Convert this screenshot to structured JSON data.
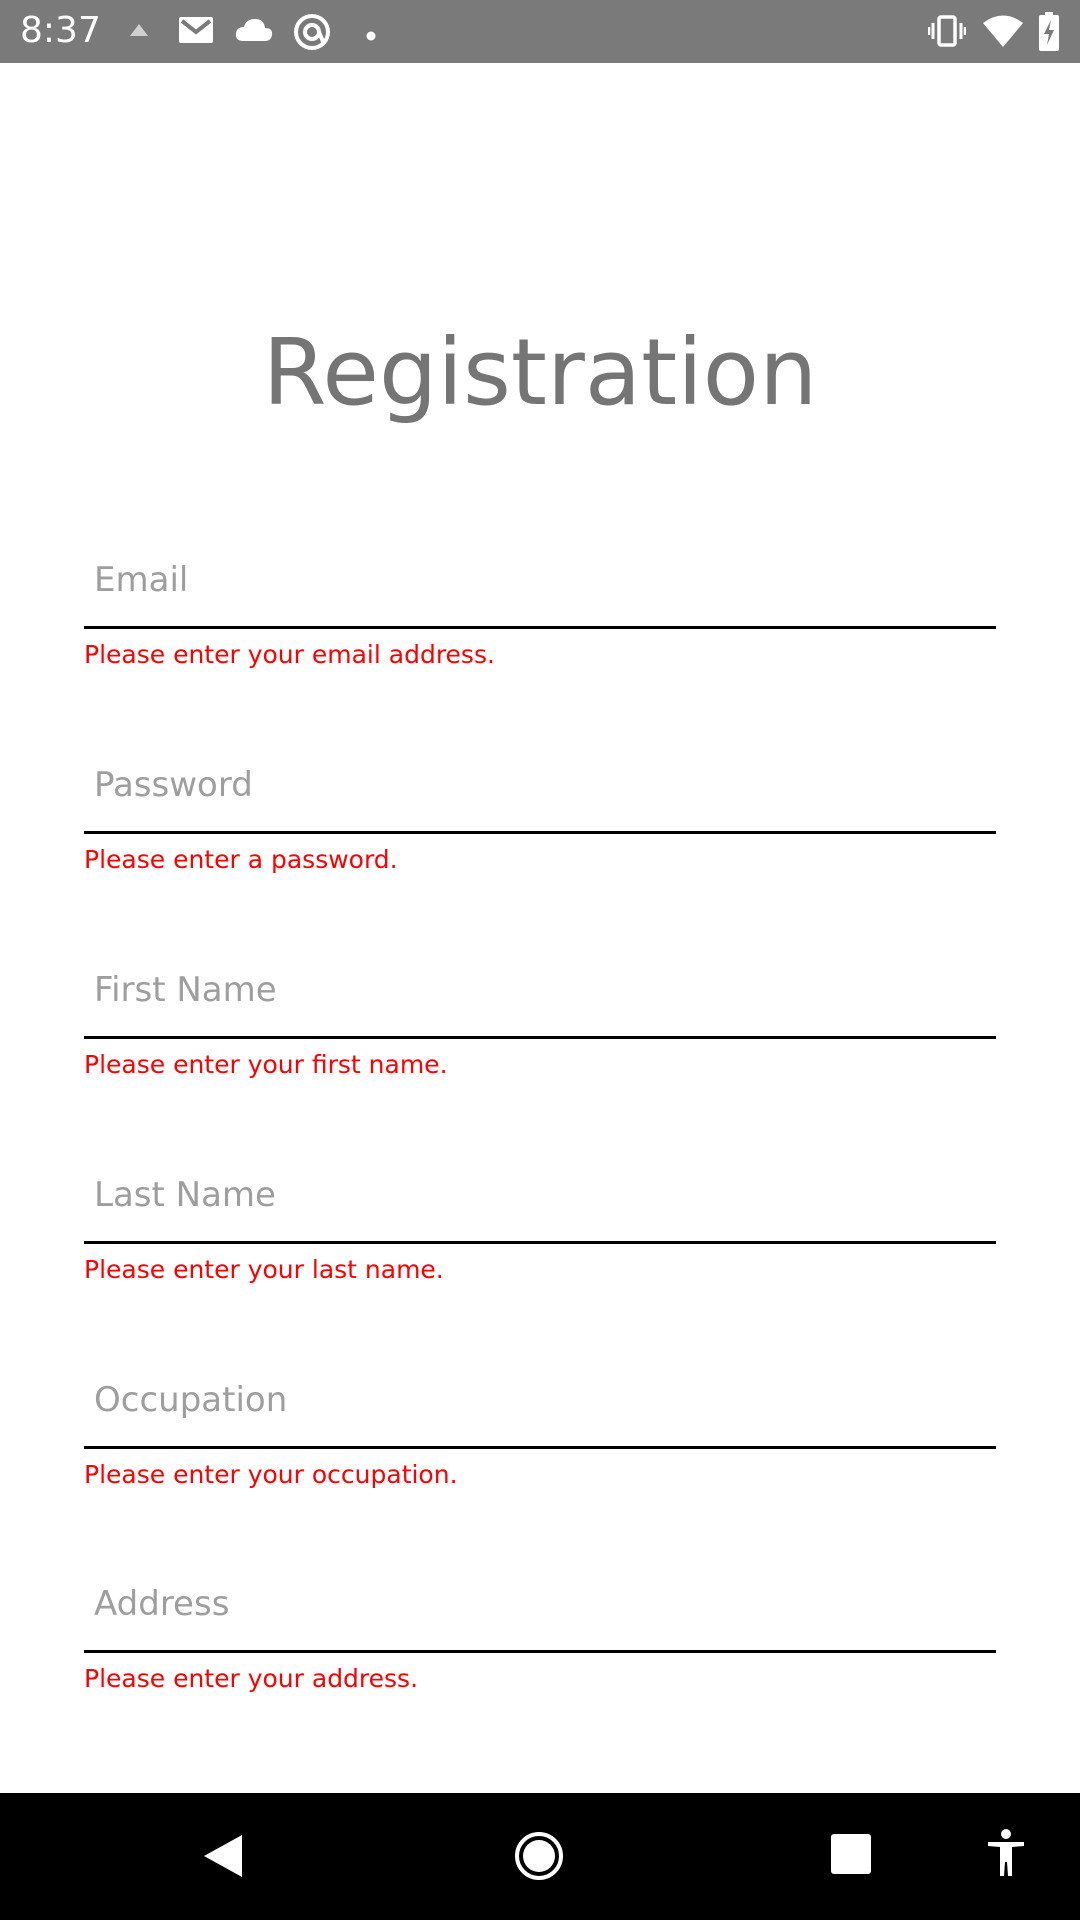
{
  "status_bar": {
    "time": "8:37",
    "left_icons": [
      "drive-sync-icon",
      "gmail-icon",
      "cloud-icon",
      "at-sign-icon",
      "dot-icon"
    ],
    "right_icons": [
      "vibrate-icon",
      "wifi-icon",
      "battery-charging-icon"
    ]
  },
  "page": {
    "title": "Registration"
  },
  "form": {
    "fields": [
      {
        "placeholder": "Email",
        "value": "",
        "error": "Please enter your email address."
      },
      {
        "placeholder": "Password",
        "value": "",
        "error": "Please enter a password."
      },
      {
        "placeholder": "First Name",
        "value": "",
        "error": "Please enter your first name."
      },
      {
        "placeholder": "Last Name",
        "value": "",
        "error": "Please enter your last name."
      },
      {
        "placeholder": "Occupation",
        "value": "",
        "error": "Please enter your occupation."
      },
      {
        "placeholder": "Address",
        "value": "",
        "error": "Please enter your address."
      }
    ]
  },
  "nav_bar": {
    "buttons": [
      "back-icon",
      "home-icon",
      "recents-icon",
      "accessibility-icon"
    ]
  },
  "colors": {
    "status_bar_bg": "#7a7a7a",
    "title_text": "#757575",
    "placeholder_text": "#9e9e9e",
    "error_text": "#ff0000",
    "field_underline": "#000000",
    "nav_bar_bg": "#000000"
  }
}
